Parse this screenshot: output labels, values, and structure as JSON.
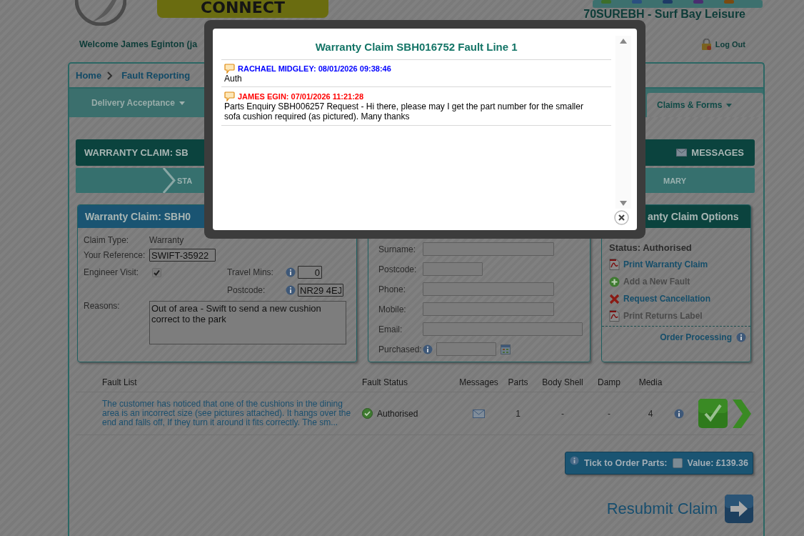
{
  "header": {
    "logo_text": "CONNECT",
    "dealer": "70SUREBH - Surf Bay Leisure",
    "welcome": "Welcome James Eginton (ja",
    "logout": "Log Out"
  },
  "breadcrumb": [
    "Home",
    "Fault Reporting"
  ],
  "nav": [
    {
      "label": "Delivery Acceptance",
      "selected": false
    },
    {
      "label": "Claims & Forms",
      "selected": true
    }
  ],
  "claim_bar": {
    "title": "WARRANTY CLAIM: SB",
    "messages": "MESSAGES"
  },
  "steps": [
    "STA",
    "MARY"
  ],
  "claim_panel": {
    "title": "Warranty Claim: SBH0",
    "claim_type_label": "Claim Type:",
    "claim_type": "Warranty",
    "reference_label": "Your Reference:",
    "reference": "SWIFT-35922",
    "engineer_label": "Engineer Visit:",
    "engineer_visit": true,
    "travel_label": "Travel Mins:",
    "travel_mins": "0",
    "postcode_label": "Postcode:",
    "postcode": "NR29 4EJ",
    "reasons_label": "Reasons:",
    "reasons": "Out of area - Swift to send a new cushion correct to the park"
  },
  "customer_panel": {
    "fields": [
      {
        "label": "Surname:",
        "kind": "medium"
      },
      {
        "label": "Postcode:",
        "kind": "short"
      },
      {
        "label": "Phone:",
        "kind": "medium"
      },
      {
        "label": "Mobile:",
        "kind": "medium"
      },
      {
        "label": "Email:",
        "kind": "wide"
      },
      {
        "label": "Purchased:",
        "kind": "date"
      }
    ]
  },
  "options_panel": {
    "title": "anty Claim Options",
    "status": "Status: Authorised",
    "items": [
      {
        "label": "Print Warranty Claim",
        "kind": "pdf",
        "disabled": false
      },
      {
        "label": "Add a New Fault",
        "kind": "add",
        "disabled": true
      },
      {
        "label": "Request Cancellation",
        "kind": "cancel",
        "disabled": false
      },
      {
        "label": "Print Returns Label",
        "kind": "pdf",
        "disabled": true
      }
    ],
    "order_processing": "Order Processing"
  },
  "fault_table": {
    "columns": [
      "Fault List",
      "Fault Status",
      "Messages",
      "Parts",
      "Body Shell",
      "Damp",
      "Media"
    ],
    "rows": [
      {
        "description": "The customer has noticed that one of the cushions in the dining area is an incorrect size (see pictures attached). It hangs over the end and falls off, If they turn it around it fits correctly. The sm...",
        "status": "Authorised",
        "parts": "1",
        "body_shell": "-",
        "damp": "-",
        "media": "4"
      }
    ]
  },
  "order_bar": {
    "label": "Tick to Order Parts:",
    "checked": false,
    "value": "Value: £139.36"
  },
  "resubmit": "Resubmit Claim",
  "modal": {
    "title": "Warranty Claim SBH016752 Fault Line 1",
    "messages": [
      {
        "author": "RACHAEL MIDGLEY: 08/01/2026 09:38:46",
        "color": "#0000ff",
        "text": "Auth"
      },
      {
        "author": "JAMES EGIN: 07/01/2026 11:21:28",
        "color": "#ff0000",
        "text": "Parts Enquiry SBH006257 Request - Hi there, please may I get the part number for the smaller sofa cushion required (as pictured). Many thanks"
      }
    ]
  }
}
